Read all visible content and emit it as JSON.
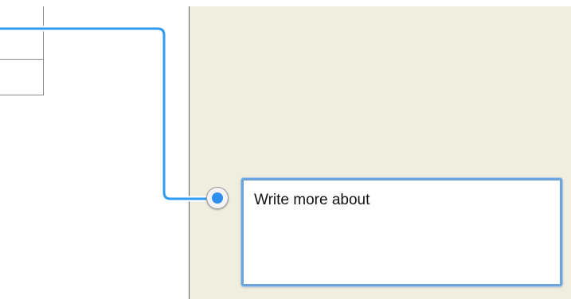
{
  "comment": {
    "text": "Write more about"
  },
  "colors": {
    "connector": "#2f9af2",
    "comment_border": "#6ea4dc",
    "margin_background": "#f0eedf",
    "anchor_fill": "#2f8ff0"
  }
}
